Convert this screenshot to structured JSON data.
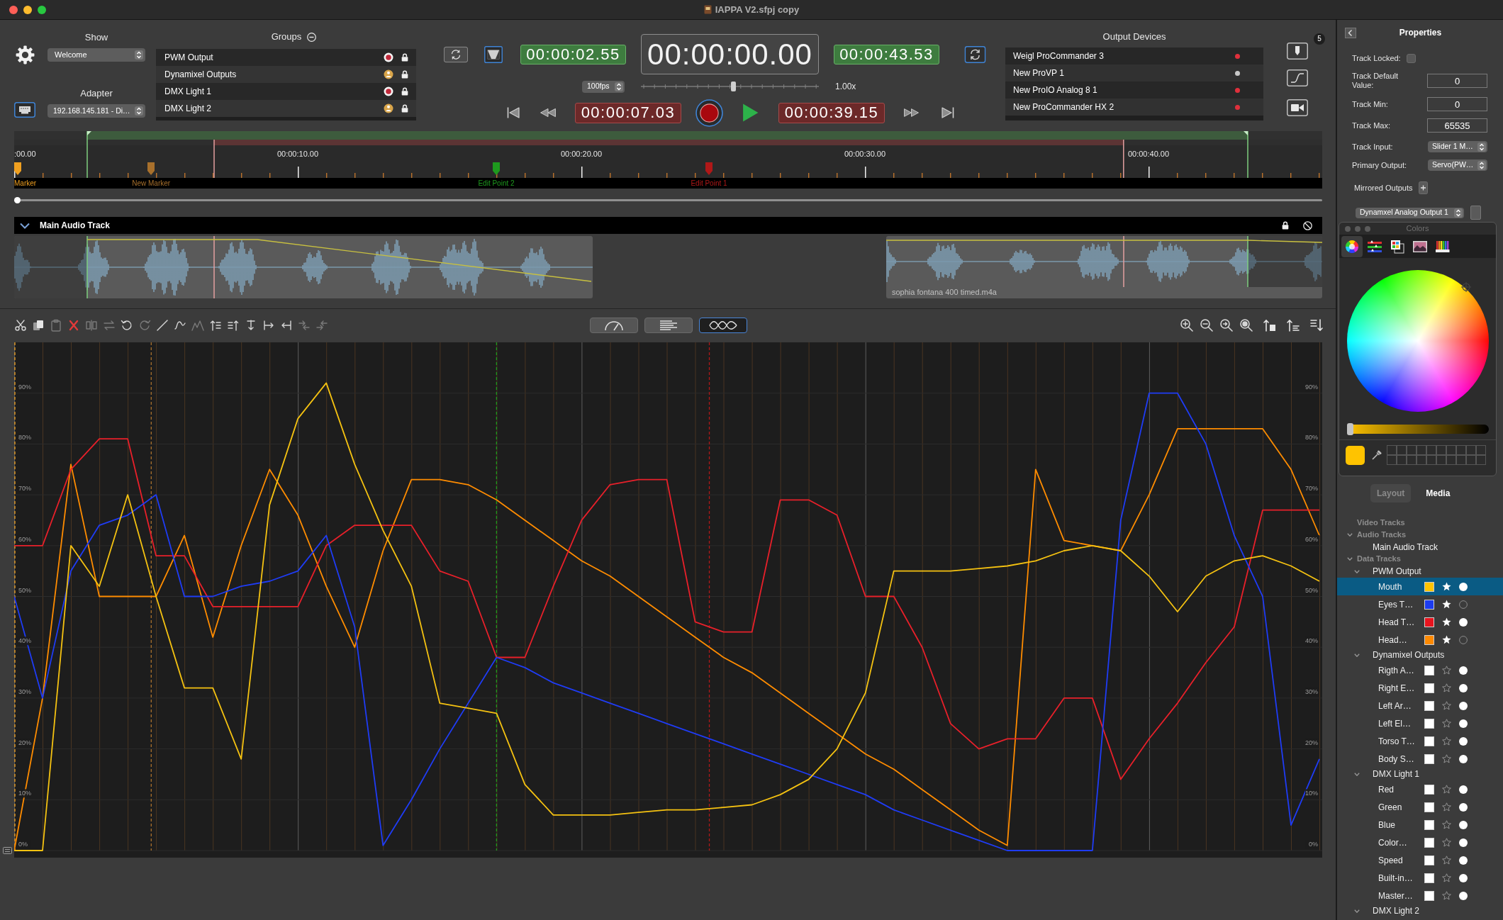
{
  "window": {
    "title": "IAPPA V2.sfpj copy"
  },
  "show": {
    "label": "Show",
    "value": "Welcome"
  },
  "adapter": {
    "label": "Adapter",
    "value": "192.168.145.181 - Di…"
  },
  "groups": {
    "title": "Groups",
    "items": [
      {
        "label": "PWM Output",
        "kind": "record"
      },
      {
        "label": "Dynamixel Outputs",
        "kind": "figure"
      },
      {
        "label": "DMX Light 1",
        "kind": "record"
      },
      {
        "label": "DMX Light 2",
        "kind": "figure"
      }
    ]
  },
  "transport": {
    "start_time": "00:00:02.55",
    "current_time": "00:00:00.00",
    "end_time": "00:00:43.53",
    "frame_rate": "100fps",
    "speed": {
      "level": 0.52,
      "reading": "1.00x"
    },
    "in_time": "00:00:07.03",
    "out_time": "00:00:39.15"
  },
  "output_devices": {
    "title": "Output Devices",
    "items": [
      {
        "label": "Weigl ProCommander 3",
        "color": "#e0303c"
      },
      {
        "label": "New ProVP 1",
        "color": "#c8c8c8"
      },
      {
        "label": "New ProIO Analog 8 1",
        "color": "#e0303c"
      },
      {
        "label": "New ProCommander HX 2",
        "color": "#e0303c"
      }
    ]
  },
  "side_tools": {
    "badge": "5"
  },
  "timeline": {
    "time_labels": [
      ":00.00",
      "00:00:10.00",
      "00:00:20.00",
      "00:00:30.00",
      "00:00:40.00"
    ],
    "markers": [
      {
        "label": "Marker",
        "color": "#f0a020"
      },
      {
        "label": "New Marker",
        "color": "#a8702c"
      },
      {
        "label": "Edit Point 2",
        "color": "#1e9a1e"
      },
      {
        "label": "Edit Point 1",
        "color": "#b01818"
      }
    ]
  },
  "audio_track": {
    "title": "Main Audio Track",
    "expanded": true,
    "clip_label": "sophia fontana 400 timed.m4a"
  },
  "graph_toolbar": {
    "views": [
      {
        "selected": false
      },
      {
        "selected": false
      },
      {
        "selected": true
      }
    ]
  },
  "graph": {
    "chart_data": {
      "type": "line",
      "categories": [
        null,
        null,
        null,
        null,
        null,
        null,
        null,
        null,
        null,
        null,
        null,
        null,
        null,
        null,
        null,
        null,
        null,
        null,
        null,
        null,
        null,
        null,
        null,
        null,
        null,
        null,
        null,
        null,
        null,
        null,
        null,
        null,
        null,
        null,
        null,
        null,
        null,
        null,
        null,
        null,
        null,
        null,
        null,
        null,
        null,
        null,
        null
      ],
      "ylim": [
        0,
        100
      ],
      "yticks": [
        {
          "value": 0,
          "label": "0%"
        },
        {
          "value": 10,
          "label": "10%"
        },
        {
          "value": 20,
          "label": "20%"
        },
        {
          "value": 30,
          "label": "30%"
        },
        {
          "value": 40,
          "label": "40%"
        },
        {
          "value": 50,
          "label": "50%"
        },
        {
          "value": 60,
          "label": "60%"
        },
        {
          "value": 70,
          "label": "70%"
        },
        {
          "value": 80,
          "label": "80%"
        },
        {
          "value": 90,
          "label": "90%"
        }
      ],
      "grid": true,
      "series": [
        {
          "color": "#f5c211",
          "values": [
            0,
            0,
            60,
            52,
            70,
            50,
            32,
            32,
            18,
            68,
            85,
            92,
            76,
            63,
            52,
            29,
            28,
            27,
            13,
            7,
            7,
            7,
            7.5,
            8,
            8,
            8.5,
            9,
            11,
            14,
            20,
            31,
            55,
            55,
            55,
            55.5,
            56,
            57,
            59,
            60,
            59,
            54,
            47,
            54,
            57,
            58,
            56,
            53
          ]
        },
        {
          "color": "#1f3cf5",
          "values": [
            50,
            30,
            55,
            64,
            66,
            70,
            50,
            50,
            52,
            53,
            55,
            62,
            44,
            1,
            10,
            20,
            29,
            38,
            36,
            33,
            31,
            29,
            27,
            25,
            23,
            21,
            19,
            17,
            15,
            13,
            11,
            8,
            6,
            4,
            2,
            0,
            0,
            0,
            0,
            65,
            90,
            90,
            80,
            62,
            50,
            5,
            18
          ]
        },
        {
          "color": "#e8202a",
          "values": [
            60,
            60,
            75,
            81,
            81,
            58,
            58,
            48,
            48,
            48,
            48,
            60,
            64,
            64,
            64,
            55,
            53,
            38,
            38,
            52,
            65,
            72,
            73,
            73,
            45,
            43,
            43,
            69,
            69,
            66,
            50,
            50,
            40,
            25,
            20,
            22,
            22,
            30,
            30,
            14,
            22,
            29,
            37,
            44,
            67,
            67,
            67
          ]
        },
        {
          "color": "#ff8c00",
          "values": [
            0,
            30,
            76,
            50,
            50,
            50,
            62,
            42,
            60,
            75,
            66,
            52,
            40,
            59,
            73,
            73,
            72,
            69,
            65,
            61,
            57,
            54,
            50,
            46,
            42,
            38,
            35,
            31,
            27,
            23,
            19,
            16,
            12,
            8,
            4,
            1,
            75,
            61,
            60,
            59,
            70,
            83,
            83,
            83,
            83,
            75,
            62
          ]
        }
      ]
    }
  },
  "properties": {
    "title": "Properties",
    "fields": [
      {
        "kind": "checkbox",
        "label": "Track Locked:",
        "checked": false
      },
      {
        "kind": "input",
        "label": "Track Default Value:",
        "value": "0"
      },
      {
        "kind": "input",
        "label": "Track Min:",
        "value": "0"
      },
      {
        "kind": "input",
        "label": "Track Max:",
        "value": "65535"
      },
      {
        "kind": "select",
        "label": "Track Input:",
        "value": "Slider 1 M…"
      },
      {
        "kind": "select",
        "label": "Primary Output:",
        "value": "Servo(PW…"
      }
    ],
    "mirrored_outputs": {
      "label": "Mirrored Outputs",
      "items": [
        {
          "value": "Dynamxel Analog Output 1"
        }
      ]
    }
  },
  "colors_panel": {
    "title": "Colors",
    "tabs": [
      {
        "selected": true
      },
      {
        "selected": false
      },
      {
        "selected": false
      },
      {
        "selected": false
      },
      {
        "selected": false
      }
    ],
    "color": "#ffc300",
    "brightness": {
      "level": 0
    }
  },
  "sidebar_tabs": [
    {
      "label": "Layout",
      "selected": false
    },
    {
      "label": "Media",
      "selected": true
    }
  ],
  "tracks_tree": [
    {
      "kind": "section",
      "label": "Video Tracks",
      "selected": false
    },
    {
      "kind": "section",
      "label": "Audio Tracks",
      "expanded": true,
      "selected": false,
      "children": [
        {
          "kind": "audio",
          "label": "Main Audio Track",
          "selected": false
        }
      ]
    },
    {
      "kind": "section",
      "label": "Data Tracks",
      "expanded": true,
      "selected": false,
      "children": [
        {
          "kind": "group",
          "label": "PWM Output",
          "expanded": true,
          "selected": false,
          "children": [
            {
              "kind": "track",
              "label": "Mouth",
              "color": "#ffc400",
              "starred": true,
              "enabled": true,
              "selected": true
            },
            {
              "kind": "track",
              "label": "Eyes T…",
              "color": "#1c3cf0",
              "starred": true,
              "enabled": false,
              "selected": false
            },
            {
              "kind": "track",
              "label": "Head T…",
              "color": "#e8141e",
              "starred": true,
              "enabled": true,
              "selected": false
            },
            {
              "kind": "track",
              "label": "Head…",
              "color": "#ff8a00",
              "starred": true,
              "enabled": false,
              "selected": false
            }
          ]
        },
        {
          "kind": "group",
          "label": "Dynamixel Outputs",
          "expanded": true,
          "selected": false,
          "children": [
            {
              "kind": "track",
              "label": "Rigth A…",
              "color": "#ffffff",
              "starred": false,
              "enabled": true,
              "selected": false
            },
            {
              "kind": "track",
              "label": "Right E…",
              "color": "#ffffff",
              "starred": false,
              "enabled": true,
              "selected": false
            },
            {
              "kind": "track",
              "label": "Left Ar…",
              "color": "#ffffff",
              "starred": false,
              "enabled": true,
              "selected": false
            },
            {
              "kind": "track",
              "label": "Left El…",
              "color": "#ffffff",
              "starred": false,
              "enabled": true,
              "selected": false
            },
            {
              "kind": "track",
              "label": "Torso T…",
              "color": "#ffffff",
              "starred": false,
              "enabled": true,
              "selected": false
            },
            {
              "kind": "track",
              "label": "Body S…",
              "color": "#ffffff",
              "starred": false,
              "enabled": true,
              "selected": false
            }
          ]
        },
        {
          "kind": "group",
          "label": "DMX Light 1",
          "expanded": true,
          "selected": false,
          "children": [
            {
              "kind": "track",
              "label": "Red",
              "color": "#ffffff",
              "starred": false,
              "enabled": true,
              "selected": false
            },
            {
              "kind": "track",
              "label": "Green",
              "color": "#ffffff",
              "starred": false,
              "enabled": true,
              "selected": false
            },
            {
              "kind": "track",
              "label": "Blue",
              "color": "#ffffff",
              "starred": false,
              "enabled": true,
              "selected": false
            },
            {
              "kind": "track",
              "label": "Color…",
              "color": "#ffffff",
              "starred": false,
              "enabled": true,
              "selected": false
            },
            {
              "kind": "track",
              "label": "Speed",
              "color": "#ffffff",
              "starred": false,
              "enabled": true,
              "selected": false
            },
            {
              "kind": "track",
              "label": "Built-in…",
              "color": "#ffffff",
              "starred": false,
              "enabled": true,
              "selected": false
            },
            {
              "kind": "track",
              "label": "Master…",
              "color": "#ffffff",
              "starred": false,
              "enabled": true,
              "selected": false
            }
          ]
        },
        {
          "kind": "group",
          "label": "DMX Light 2",
          "expanded": true,
          "selected": false
        }
      ]
    }
  ]
}
